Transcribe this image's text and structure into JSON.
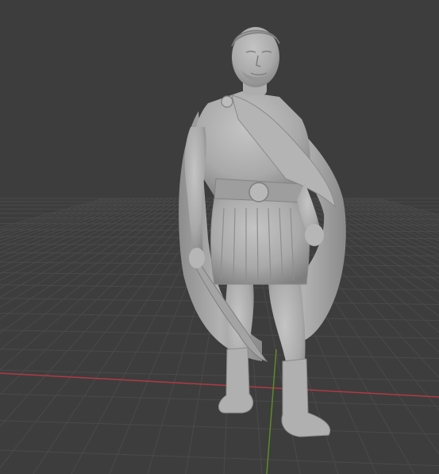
{
  "viewport": {
    "background": "#3d3d3d",
    "grid_color": "#4a4a4a",
    "x_axis_color": "#b03a44",
    "y_axis_color": "#5f8a2a"
  },
  "model": {
    "name": "roman-statue",
    "material_color": "#a9a9a9",
    "shadow_color": "#7e7e7e",
    "highlight_color": "#c4c4c4"
  }
}
